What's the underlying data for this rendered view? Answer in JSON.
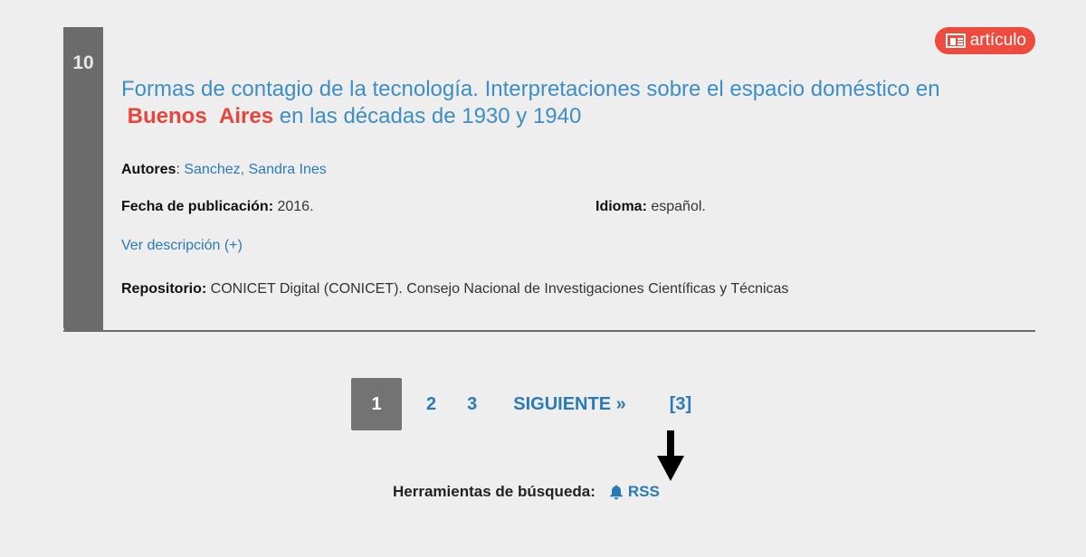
{
  "result": {
    "number": "10",
    "type_badge": "artículo",
    "type_icon": "newspaper-icon",
    "title_part1": "Formas de contagio de la tecnología. Interpretaciones sobre el espacio doméstico en ",
    "title_highlight1": "Buenos",
    "title_highlight2": "Aires",
    "title_part2": " en las décadas de 1930 y 1940",
    "autores_label": "Autores",
    "autores_value": "Sanchez, Sandra Ines",
    "fecha_label": "Fecha de publicación:",
    "fecha_value": "2016.",
    "idioma_label": "Idioma:",
    "idioma_value": "español.",
    "ver_descripcion": "Ver descripción (+)",
    "repositorio_label": "Repositorio:",
    "repositorio_value": "CONICET Digital (CONICET). Consejo Nacional de Investigaciones Científicas y Técnicas"
  },
  "pagination": {
    "current": "1",
    "pages": [
      "2",
      "3"
    ],
    "next_label": "SIGUIENTE »",
    "last_label": "[3]"
  },
  "search_tools": {
    "label": "Herramientas de búsqueda:",
    "rss_label": "RSS",
    "rss_icon": "bell-icon"
  },
  "colors": {
    "background": "#eeeeee",
    "sidebar_gray": "#6b6b6b",
    "link_blue": "#2a7ab8",
    "title_blue": "#3d8ec4",
    "highlight_red": "#e8453a",
    "badge_red": "#ee4b3f"
  }
}
